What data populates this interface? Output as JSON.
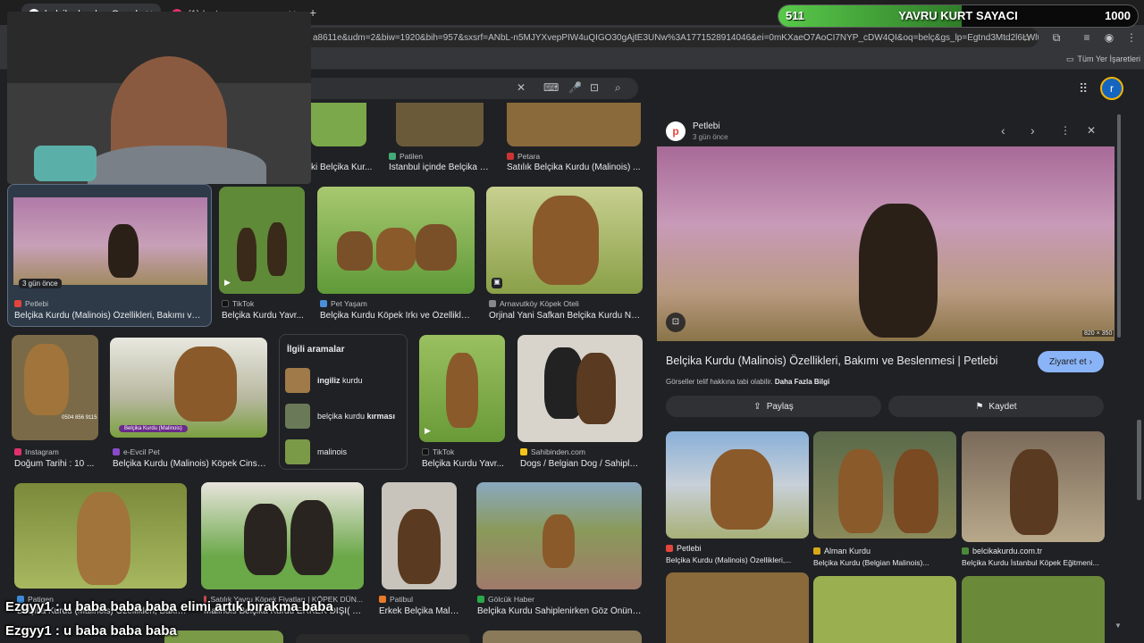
{
  "browser": {
    "tabs": [
      {
        "title": "belçika kurdu - Google'da Ara"
      },
      {
        "title": "(1) Instagram"
      }
    ],
    "new_tab": "+",
    "url": "a8611e&udm=2&biw=1920&bih=957&sxsrf=ANbL-n5MJYXvepPIW4uQIGO30gAjtE3UNw%3A1771528914046&ei=0mKXaeO7AoCI7NYP_cDW4QI&oq=belç&gs_lp=Egtnd3Mtd2l6LWltZyIFY...",
    "bookmarks_label": "Tüm Yer İşaretleri"
  },
  "counter": {
    "current": "511",
    "label": "YAVRU KURT SAYACI",
    "goal": "1000",
    "progress": 0.511
  },
  "results": {
    "row0": [
      {
        "caption": "ki Belçika Kur..."
      },
      {
        "source": "Patilen",
        "caption": "İstanbul içinde Belçika K..."
      },
      {
        "source": "Petara",
        "caption": "Satılık Belçika Kurdu (Malinois) ..."
      }
    ],
    "row1": [
      {
        "badge": "3 gün önce",
        "source": "Petlebi",
        "caption": "Belçika Kurdu (Malinois) Özellikleri, Bakımı ve ..."
      },
      {
        "source": "TikTok",
        "caption": "Belçika Kurdu Yavr..."
      },
      {
        "source": "Pet Yaşam",
        "caption": "Belçika Kurdu Köpek Irkı ve Özellikler..."
      },
      {
        "source": "Arnavutköy Köpek Oteli",
        "caption": "Orjinal Yani Safkan Belçika Kurdu Na..."
      }
    ],
    "row2": [
      {
        "source": "Instagram",
        "caption": "Doğum Tarihi : 10 ...",
        "overlay": "0504 856 9115"
      },
      {
        "source": "e-Evcil Pet",
        "caption": "Belçika Kurdu (Malinois) Köpek Cinsi ...",
        "overlay": "Belçika Kurdu (Malinois)"
      },
      {
        "source": "TikTok",
        "caption": "Belçika Kurdu Yavr..."
      },
      {
        "source": "Sahibinden.com",
        "caption": "Dogs / Belgian Dog / Sahiple..."
      }
    ],
    "row3": [
      {
        "source": "Patigen",
        "caption": "Belçika Kurdu (Malinois) Özellikleri, Bakımı ..."
      },
      {
        "source": "Satılık Yavru Köpek Fiyatları | KÖPEK DÜN...",
        "caption": "Malinois Belçika Kurdu ERKEK DİŞİ( bel..."
      },
      {
        "source": "Patibul",
        "caption": "Erkek Belçika Mali..."
      },
      {
        "source": "Gölcük Haber",
        "caption": "Belçika Kurdu Sahiplenirken Göz Önünd..."
      }
    ]
  },
  "related": {
    "title": "İlgili aramalar",
    "items": [
      {
        "bold": "ingiliz",
        "rest": " kurdu"
      },
      {
        "bold": "",
        "rest": "belçika kurdu ",
        "bold2": "kırması"
      },
      {
        "bold": "",
        "rest": "malinois"
      }
    ]
  },
  "panel": {
    "source": "Petlebi",
    "time": "3 gün önce",
    "size": "820 × 350",
    "title": "Belçika Kurdu (Malinois) Özellikleri, Bakımı ve Beslenmesi | Petlebi",
    "visit": "Ziyaret et",
    "copyright": "Görseller telif hakkına tabi olabilir.",
    "more_info": "Daha Fazla Bilgi",
    "share": "Paylaş",
    "save": "Kaydet",
    "related": [
      {
        "source": "Petlebi",
        "caption": "Belçika Kurdu (Malinois) Özellikleri,..."
      },
      {
        "source": "Alman Kurdu",
        "caption": "Belçika Kurdu (Belgian Malinois)..."
      },
      {
        "source": "belcikakurdu.com.tr",
        "caption": "Belçika Kurdu İstanbul Köpek Eğitmeni..."
      }
    ]
  },
  "chat": [
    {
      "text": "Ezgyy1 : u baba baba baba elimi artık bırakma baba"
    },
    {
      "text": "Ezgyy1 : u baba baba baba"
    }
  ],
  "avatar": {
    "letter": "r"
  }
}
